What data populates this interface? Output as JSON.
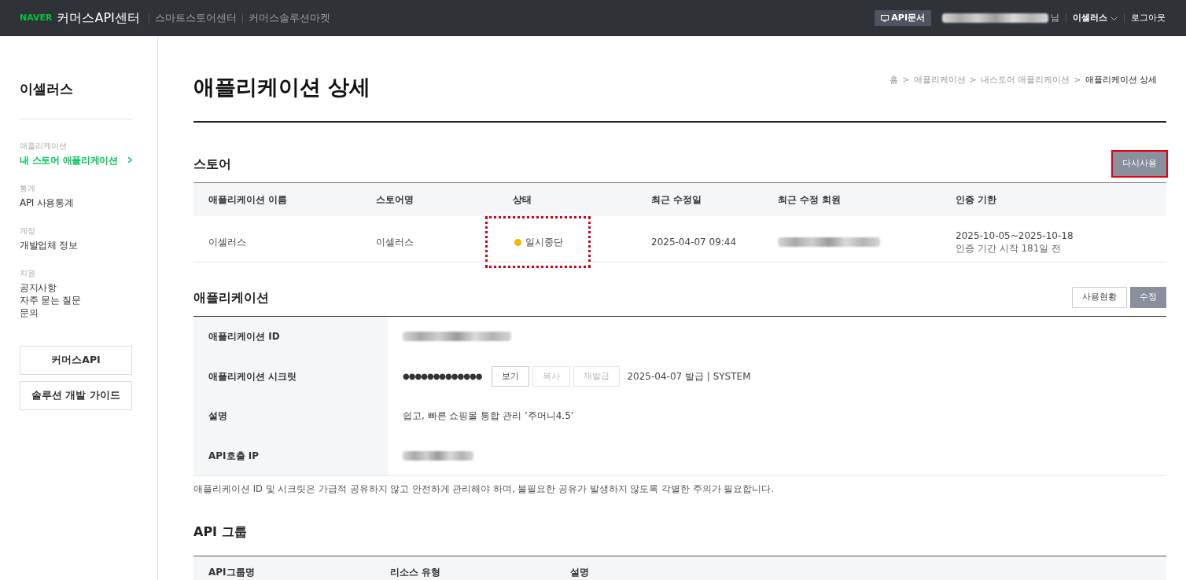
{
  "header": {
    "brand": "NAVER",
    "title": "커머스API센터",
    "links": [
      "스마트스토어센터",
      "커머스솔루션마켓"
    ],
    "docs_button": "API문서",
    "user": {
      "redacted": true,
      "suffix": "님"
    },
    "account_menu": "이셀러스",
    "logout": "로그아웃"
  },
  "sidebar": {
    "title": "이셀러스",
    "sections": [
      {
        "label": "애플리케이션",
        "items": [
          {
            "text": "내 스토어 애플리케이션",
            "selected": true
          }
        ]
      },
      {
        "label": "통계",
        "items": [
          {
            "text": "API 사용통계",
            "selected": false
          }
        ]
      },
      {
        "label": "계정",
        "items": [
          {
            "text": "개발업체 정보",
            "selected": false
          }
        ]
      },
      {
        "label": "지원",
        "items": [
          {
            "text": "공지사항",
            "selected": false
          },
          {
            "text": "자주 묻는 질문",
            "selected": false
          },
          {
            "text": "문의",
            "selected": false
          }
        ]
      }
    ],
    "buttons": [
      "커머스API",
      "솔루션 개발 가이드"
    ]
  },
  "page": {
    "title": "애플리케이션 상세",
    "breadcrumb": [
      "홈",
      "애플리케이션",
      "내스토어 애플리케이션",
      "애플리케이션 상세"
    ],
    "breadcrumb_separator": ">"
  },
  "store": {
    "title": "스토어",
    "action": {
      "label": "다시사용",
      "highlighted": true
    },
    "columns": [
      "애플리케이션 이름",
      "스토어명",
      "상태",
      "최근 수정일",
      "최근 수정 회원",
      "인증 기한"
    ],
    "row": {
      "app_name": "이셀러스",
      "store_name": "이셀러스",
      "status": {
        "text": "일시중단",
        "color": "#f5b800",
        "highlighted": true
      },
      "modified": "2025-04-07 09:44",
      "modifier_redacted": true,
      "period": "2025-10-05~2025-10-18",
      "period_note": "인증 기간 시작 181일 전"
    }
  },
  "application": {
    "title": "애플리케이션",
    "actions": [
      {
        "label": "사용현황",
        "kind": "outline"
      },
      {
        "label": "수정",
        "kind": "filled"
      }
    ],
    "fields": [
      {
        "label": "애플리케이션 ID",
        "kind": "redacted"
      },
      {
        "label": "애플리케이션 시크릿",
        "kind": "secret",
        "value": "●●●●●●●●●●●●●",
        "buttons": [
          {
            "label": "보기",
            "disabled": false
          },
          {
            "label": "복사",
            "disabled": true
          },
          {
            "label": "재발급",
            "disabled": true
          }
        ],
        "note": "2025-04-07 발급 | SYSTEM"
      },
      {
        "label": "설명",
        "kind": "text",
        "value": "쉽고, 빠른 쇼핑몰 통합 관리 ‘주머니4.5’"
      },
      {
        "label": "API호출 IP",
        "kind": "redacted"
      }
    ],
    "notice": "애플리케이션 ID 및 시크릿은 가급적 공유하지 않고 안전하게 관리해야 하며, 불필요한 공유가 발생하지 않도록 각별한 주의가 필요합니다."
  },
  "api_groups": {
    "title": "API 그룹",
    "columns": [
      "API그룹명",
      "리소스 유형",
      "설명"
    ]
  }
}
